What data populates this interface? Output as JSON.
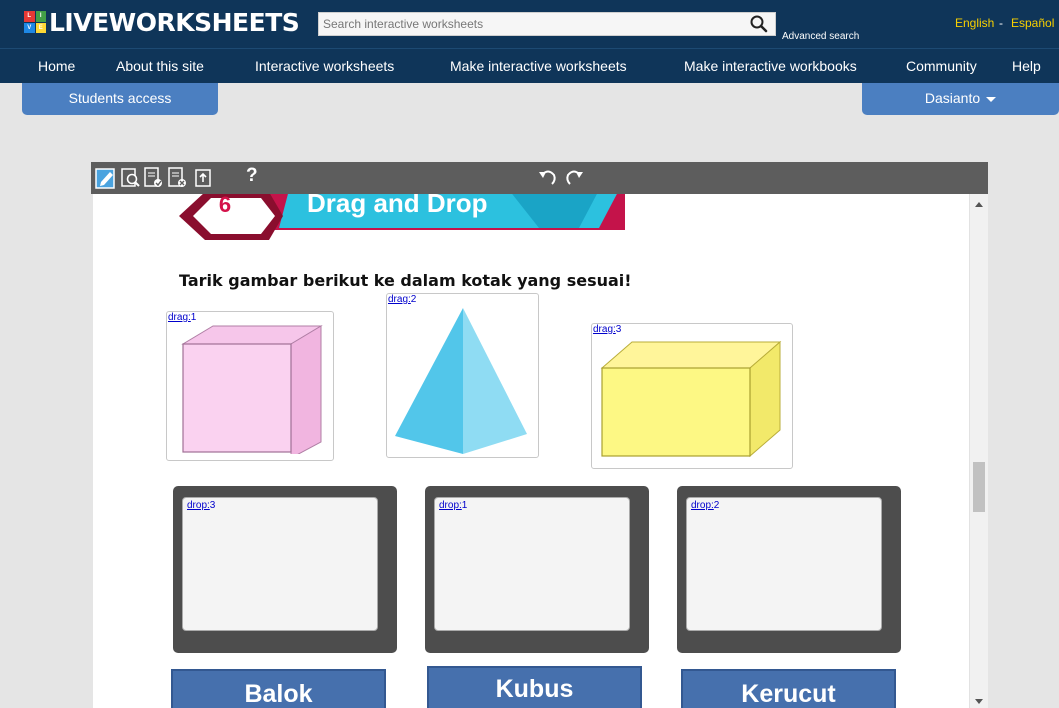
{
  "header": {
    "logo_text": "LIVEWORKSHEETS",
    "logo_letters": [
      "L",
      "I",
      "V",
      "E"
    ],
    "search_placeholder": "Search interactive worksheets",
    "advanced_search": "Advanced search",
    "lang_english": "English",
    "lang_separator": "-",
    "lang_spanish": "Español"
  },
  "nav": {
    "home": "Home",
    "about": "About this site",
    "interactive": "Interactive worksheets",
    "make_worksheets": "Make interactive worksheets",
    "make_workbooks": "Make interactive workbooks",
    "community": "Community",
    "help": "Help"
  },
  "tabs": {
    "students": "Students access",
    "user": "Dasianto"
  },
  "toolbar": {
    "help": "?"
  },
  "worksheet": {
    "banner_number": "6",
    "banner_title": "Drag and Drop",
    "instruction": "Tarik gambar berikut ke dalam kotak yang sesuai!",
    "drag_items": [
      {
        "prefix": "drag:",
        "num": "1",
        "shape": "cube"
      },
      {
        "prefix": "drag:",
        "num": "2",
        "shape": "pyramid"
      },
      {
        "prefix": "drag:",
        "num": "3",
        "shape": "cuboid"
      }
    ],
    "drop_zones": [
      {
        "prefix": "drop:",
        "num": "3"
      },
      {
        "prefix": "drop:",
        "num": "1"
      },
      {
        "prefix": "drop:",
        "num": "2"
      }
    ],
    "name_buttons": [
      "Balok",
      "Kubus",
      "Kerucut"
    ]
  },
  "colors": {
    "header_bg": "#0f3559",
    "tab_bg": "#4b7fc1",
    "lang_color": "#f7d000",
    "name_button_bg": "#4670ad",
    "cube_fill": "#fad2f0",
    "pyramid_fill": "#6fd3ee",
    "cuboid_fill": "#fdf884"
  }
}
